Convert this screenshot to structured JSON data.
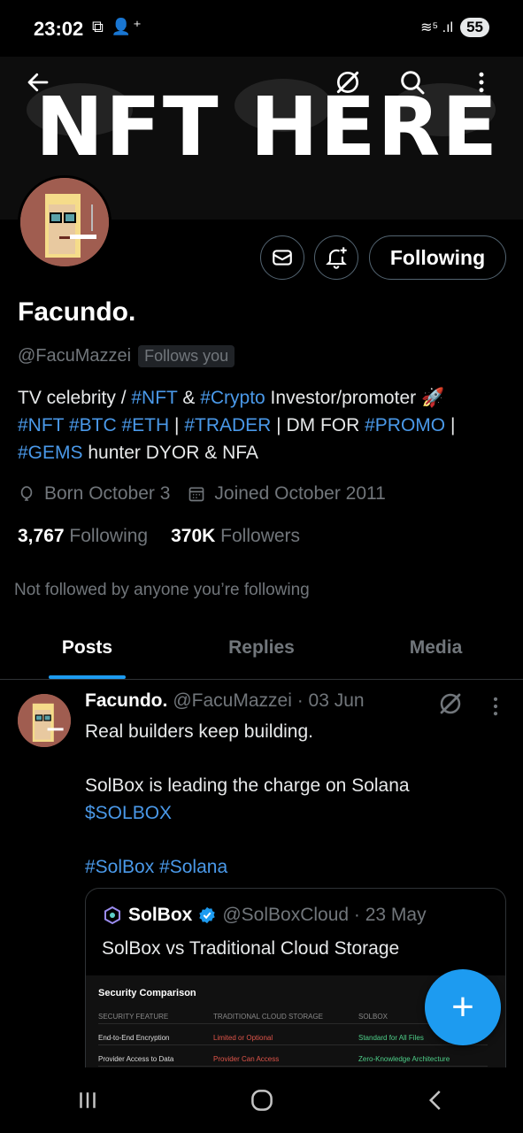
{
  "status_bar": {
    "time": "23:02",
    "left_icons": "⧉ 👤⁺",
    "signal": "≋⁵ .ıl",
    "battery": "55"
  },
  "banner": {
    "text": "NFT HERE"
  },
  "top_actions": {
    "back_icon": "arrow-left-icon",
    "grok_icon": "grok-icon",
    "search_icon": "search-icon",
    "more_icon": "more-vertical-icon"
  },
  "profile": {
    "name": "Facundo.",
    "handle": "@FacuMazzei",
    "follows_you": "Follows you",
    "following_button": "Following",
    "bio": {
      "line1_a": "TV celebrity / ",
      "line1_tag1": "#NFT",
      "line1_b": " & ",
      "line1_tag2": "#Crypto",
      "line1_c": " Investor/promoter 🚀",
      "line2_tag1": "#NFT",
      "line2_tag2": "#BTC",
      "line2_tag3": "#ETH",
      "line2_a": " | ",
      "line2_tag4": "#TRADER",
      "line2_b": " | DM FOR ",
      "line2_tag5": "#PROMO",
      "line2_c": " |",
      "line3_tag1": "#GEMS",
      "line3_a": " hunter DYOR & NFA"
    },
    "born": "Born October 3",
    "joined": "Joined October 2011",
    "following_count": "3,767",
    "following_label": "Following",
    "followers_count": "370K",
    "followers_label": "Followers",
    "not_followed": "Not followed by anyone you’re following"
  },
  "tabs": [
    {
      "label": "Posts"
    },
    {
      "label": "Replies"
    },
    {
      "label": "Media"
    }
  ],
  "post": {
    "author": "Facundo.",
    "handle_date": "@FacuMazzei · 03 Jun",
    "line1": "Real builders keep building.",
    "line2": "SolBox is leading the charge on Solana",
    "cashtag": "$SOLBOX",
    "tag1": "#SolBox",
    "tag2": "#Solana",
    "quote": {
      "author": "SolBox",
      "handle_date": "@SolBoxCloud · 23 May",
      "text": "SolBox vs Traditional Cloud Storage",
      "image": {
        "title": "Security Comparison",
        "headers": [
          "SECURITY FEATURE",
          "TRADITIONAL CLOUD STORAGE",
          "SOLBOX"
        ],
        "rows": [
          [
            "End-to-End Encryption",
            "Limited or Optional",
            "Standard for All Files"
          ],
          [
            "Provider Access to Data",
            "Provider Can Access",
            "Zero-Knowledge Architecture"
          ]
        ]
      }
    }
  },
  "fab": {
    "label": "+"
  },
  "colors": {
    "accent": "#1d9bf0",
    "link": "#4a99e9",
    "muted": "#71767b"
  }
}
